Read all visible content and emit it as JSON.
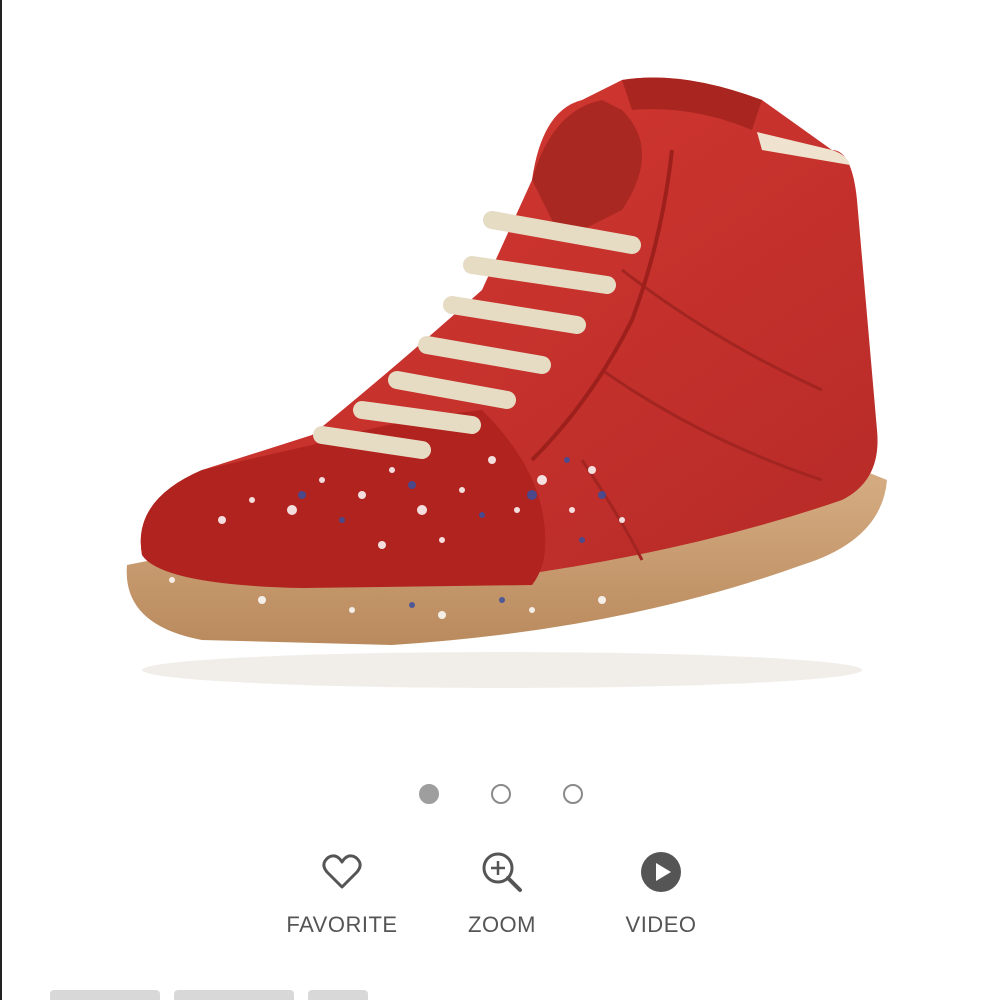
{
  "carousel": {
    "dots": [
      {
        "state": "active"
      },
      {
        "state": "inactive"
      },
      {
        "state": "inactive"
      }
    ]
  },
  "actions": {
    "favorite": {
      "label": "FAVORITE",
      "icon": "heart-icon"
    },
    "zoom": {
      "label": "ZOOM",
      "icon": "zoom-in-icon"
    },
    "video": {
      "label": "VIDEO",
      "icon": "play-icon"
    }
  },
  "colors": {
    "shoe_red": "#c8302c",
    "sole": "#c79a6f",
    "laces": "#e6dcc4",
    "icon_gray": "#555555",
    "dot_active": "#9e9e9e"
  }
}
